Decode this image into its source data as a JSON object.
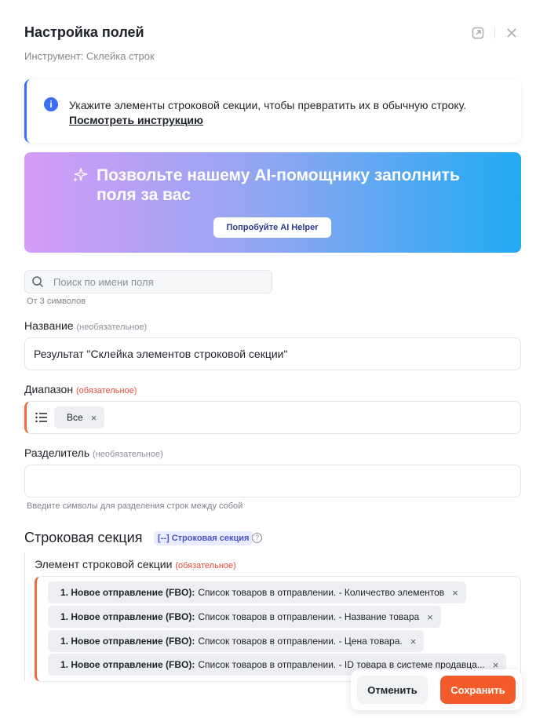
{
  "header": {
    "title": "Настройка полей",
    "subtitle": "Инструмент: Склейка строк"
  },
  "info": {
    "text": "Укажите элементы строковой секции, чтобы превратить их в обычную строку.",
    "link": "Посмотреть инструкцию"
  },
  "ai_banner": {
    "title": "Позвольте нашему AI-помощнику заполнить поля за вас",
    "button": "Попробуйте AI Helper"
  },
  "search": {
    "placeholder": "Поиск по имени поля",
    "hint": "От 3 символов"
  },
  "name_field": {
    "label": "Название",
    "qualifier": "(необязательное)",
    "value": "Результат \"Склейка элементов строковой секции\""
  },
  "range_field": {
    "label": "Диапазон",
    "qualifier": "(обязательное)",
    "chip": "Все"
  },
  "separator_field": {
    "label": "Разделитель",
    "qualifier": "(необязательное)",
    "value": "",
    "hint": "Введите символы для разделения строк между собой"
  },
  "row_section": {
    "title": "Строковая секция",
    "badge": "[--] Строковая секция",
    "help": "?",
    "element_label": "Элемент строковой секции",
    "element_qualifier": "(обязательное)",
    "items": [
      {
        "prefix": "1. Новое отправление (FBO):",
        "text": "Список товаров в отправлении. - Количество элементов"
      },
      {
        "prefix": "1. Новое отправление (FBO):",
        "text": "Список товаров в отправлении. - Название товара"
      },
      {
        "prefix": "1. Новое отправление (FBO):",
        "text": "Список товаров в отправлении. - Цена товара."
      },
      {
        "prefix": "1. Новое отправление (FBO):",
        "text": "Список товаров в отправлении. - ID товара в системе продавца..."
      }
    ]
  },
  "footer": {
    "cancel": "Отменить",
    "save": "Сохранить"
  },
  "colors": {
    "accent": "#f45b2a",
    "info": "#3b6ef5",
    "required": "#e74c3c"
  }
}
